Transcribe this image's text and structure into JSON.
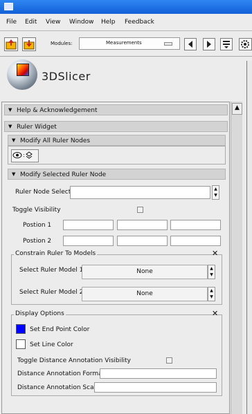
{
  "menu": {
    "file": "File",
    "edit": "Edit",
    "view": "View",
    "window": "Window",
    "help": "Help",
    "feedback": "Feedback"
  },
  "toolbar": {
    "modules_label": "Modules:",
    "modules_value": "Measurements"
  },
  "logo": {
    "text": "3DSlicer"
  },
  "sections": {
    "help": "Help & Acknowledgement",
    "ruler_widget": "Ruler Widget",
    "modify_all": "Modify All Ruler Nodes",
    "modify_selected": "Modify Selected Ruler Node"
  },
  "fields": {
    "ruler_node_select": "Ruler Node Select:",
    "toggle_visibility": "Toggle Visibility",
    "position1": "Postion 1",
    "position2": "Postion 2"
  },
  "constrain": {
    "title": "Constrain Ruler To Models",
    "model1_label": "Select Ruler Model 1:",
    "model1_value": "None",
    "model2_label": "Select Ruler Model 2:",
    "model2_value": "None"
  },
  "display": {
    "title": "Display Options",
    "end_point_color_label": "Set End Point Color",
    "end_point_color": "#0000ff",
    "line_color_label": "Set Line Color",
    "line_color": "#ffffff",
    "toggle_annotation": "Toggle Distance Annotation Visibility",
    "annotation_format": "Distance Annotation Format",
    "annotation_scale": "Distance Annotation Scale"
  }
}
